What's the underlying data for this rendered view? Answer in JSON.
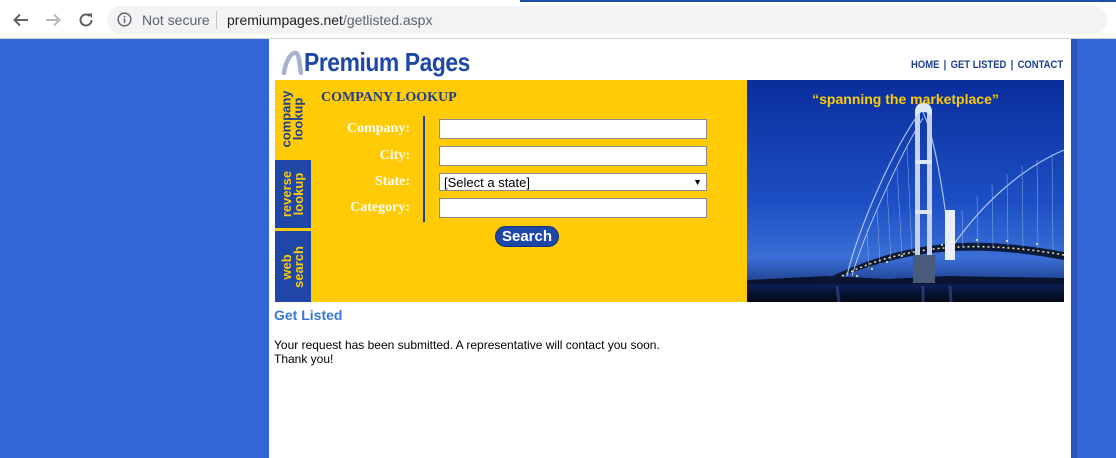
{
  "browser": {
    "security_label": "Not secure",
    "url_domain": "premiumpages.net",
    "url_path": "/getlisted.aspx"
  },
  "header": {
    "logo_text": "Premium Pages",
    "nav": [
      {
        "label": "HOME"
      },
      {
        "label": "GET LISTED"
      },
      {
        "label": "CONTACT"
      }
    ]
  },
  "tabs": [
    {
      "label_line1": "company",
      "label_line2": "lookup"
    },
    {
      "label_line1": "reverse",
      "label_line2": "lookup"
    },
    {
      "label_line1": "web",
      "label_line2": "search"
    }
  ],
  "lookup_form": {
    "heading": "COMPANY LOOKUP",
    "company_label": "Company:",
    "city_label": "City:",
    "state_label": "State:",
    "category_label": "Category:",
    "company_value": "",
    "city_value": "",
    "state_selected": "[Select a state]",
    "category_value": "",
    "search_label": "Search"
  },
  "banner": {
    "tagline": "“spanning the marketplace”"
  },
  "content": {
    "title": "Get Listed",
    "message_line1": "Your request has been submitted. A representative will contact you soon.",
    "message_line2": "Thank you!"
  },
  "colors": {
    "background": "#3265d6",
    "brand_blue": "#1e47a8",
    "panel_yellow": "#fecb06",
    "link_blue": "#3a77d4"
  }
}
